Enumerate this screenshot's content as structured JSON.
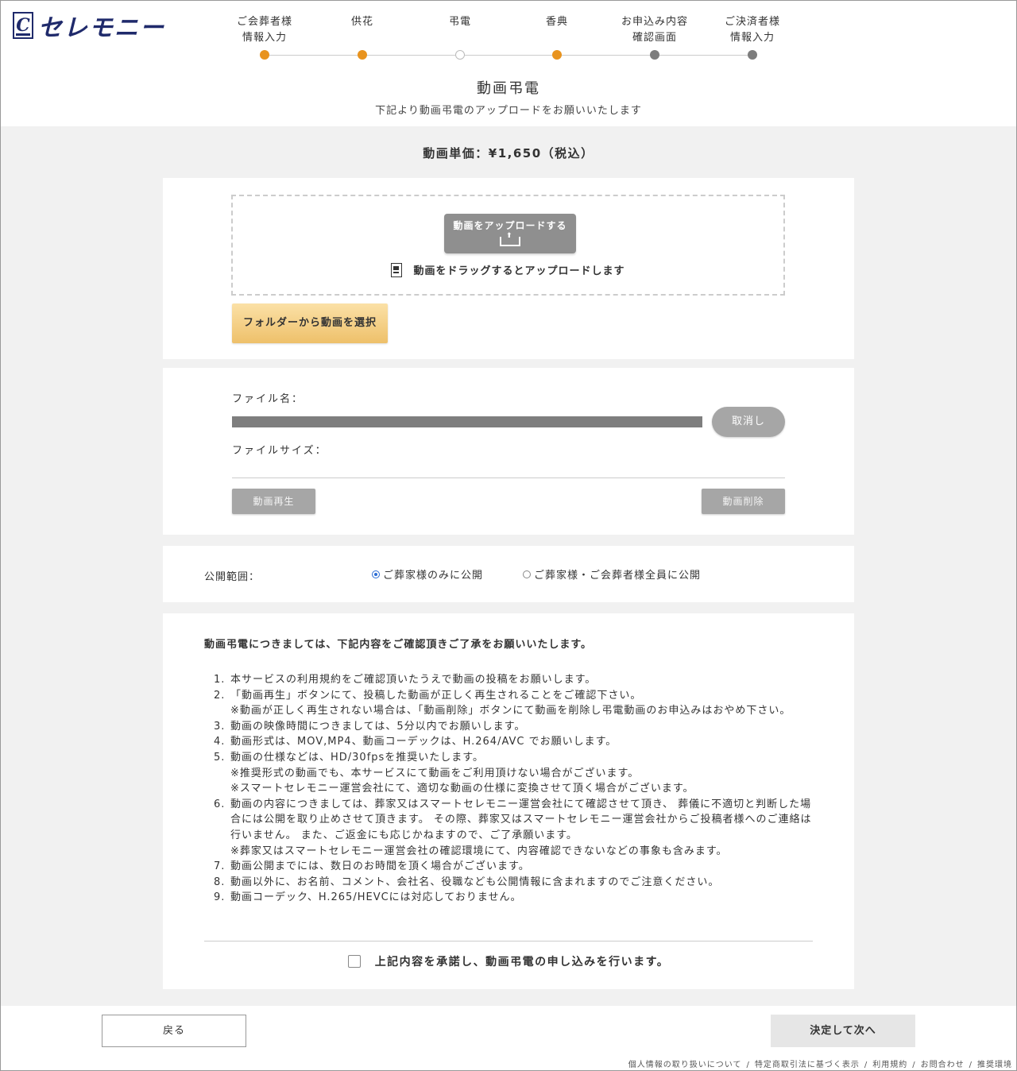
{
  "header": {
    "logo_mark": "C",
    "logo_text": "セレモニー",
    "steps": [
      {
        "line1": "ご会葬者様",
        "line2": "情報入力",
        "state": "done"
      },
      {
        "line1": "供花",
        "line2": "",
        "state": "done"
      },
      {
        "line1": "弔電",
        "line2": "",
        "state": "skipped"
      },
      {
        "line1": "香典",
        "line2": "",
        "state": "current"
      },
      {
        "line1": "お申込み内容",
        "line2": "確認画面",
        "state": "pending"
      },
      {
        "line1": "ご決済者様",
        "line2": "情報入力",
        "state": "pending"
      }
    ],
    "step_colors": {
      "done": "#e8931e",
      "pending": "#7d7d7d",
      "skipped": "#ffffff"
    }
  },
  "page": {
    "title": "動画弔電",
    "subtitle": "下記より動画弔電のアップロードをお願いいたします",
    "unit_price": "動画単価：¥1,650（税込）"
  },
  "upload": {
    "upload_button": "動画をアップロードする",
    "drag_text": "動画をドラッグするとアップロードします",
    "folder_button": "フォルダーから動画を選択"
  },
  "file": {
    "name_label": "ファイル名：",
    "size_label": "ファイルサイズ：",
    "cancel_button": "取消し",
    "play_button": "動画再生",
    "delete_button": "動画削除",
    "progress_percent": 100
  },
  "visibility": {
    "label": "公開範囲：",
    "options": [
      {
        "label": "ご葬家様のみに公開",
        "selected": true
      },
      {
        "label": "ご葬家様・ご会葬者様全員に公開",
        "selected": false
      }
    ]
  },
  "terms": {
    "heading": "動画弔電につきましては、下記内容をご確認頂きご了承をお願いいたします。",
    "items": [
      {
        "num": "1.",
        "text": "本サービスの利用規約をご確認頂いたうえで動画の投稿をお願いします。",
        "notes": []
      },
      {
        "num": "2.",
        "text": "「動画再生」ボタンにて、投稿した動画が正しく再生されることをご確認下さい。",
        "notes": [
          "※動画が正しく再生されない場合は、「動画削除」ボタンにて動画を削除し弔電動画のお申込みはおやめ下さい。"
        ]
      },
      {
        "num": "3.",
        "text": "動画の映像時間につきましては、5分以内でお願いします。",
        "notes": []
      },
      {
        "num": "4.",
        "text": "動画形式は、MOV,MP4、動画コーデックは、H.264/AVC でお願いします。",
        "notes": []
      },
      {
        "num": "5.",
        "text": "動画の仕様などは、HD/30fpsを推奨いたします。",
        "notes": [
          "※推奨形式の動画でも、本サービスにて動画をご利用頂けない場合がございます。",
          "※スマートセレモニー運営会社にて、適切な動画の仕様に変換させて頂く場合がございます。"
        ]
      },
      {
        "num": "6.",
        "text": "動画の内容につきましては、葬家又はスマートセレモニー運営会社にて確認させて頂き、 葬儀に不適切と判断した場合には公開を取り止めさせて頂きます。 その際、葬家又はスマートセレモニー運営会社からご投稿者様へのご連絡は行いません。 また、ご返金にも応じかねますので、ご了承願います。",
        "notes": [
          "※葬家又はスマートセレモニー運営会社の確認環境にて、内容確認できないなどの事象も含みます。"
        ]
      },
      {
        "num": "7.",
        "text": "動画公開までには、数日のお時間を頂く場合がございます。",
        "notes": []
      },
      {
        "num": "8.",
        "text": "動画以外に、お名前、コメント、会社名、役職なども公開情報に含まれますのでご注意ください。",
        "notes": []
      },
      {
        "num": "9.",
        "text": "動画コーデック、H.265/HEVCには対応しておりません。",
        "notes": []
      }
    ],
    "agree_label": "上記内容を承諾し、動画弔電の申し込みを行います。"
  },
  "nav": {
    "back_button": "戻る",
    "next_button": "決定して次へ"
  },
  "footer": {
    "links": [
      "個人情報の取り扱いについて",
      "特定商取引法に基づく表示",
      "利用規約",
      "お問合わせ",
      "推奨環境"
    ],
    "separator": "/"
  }
}
